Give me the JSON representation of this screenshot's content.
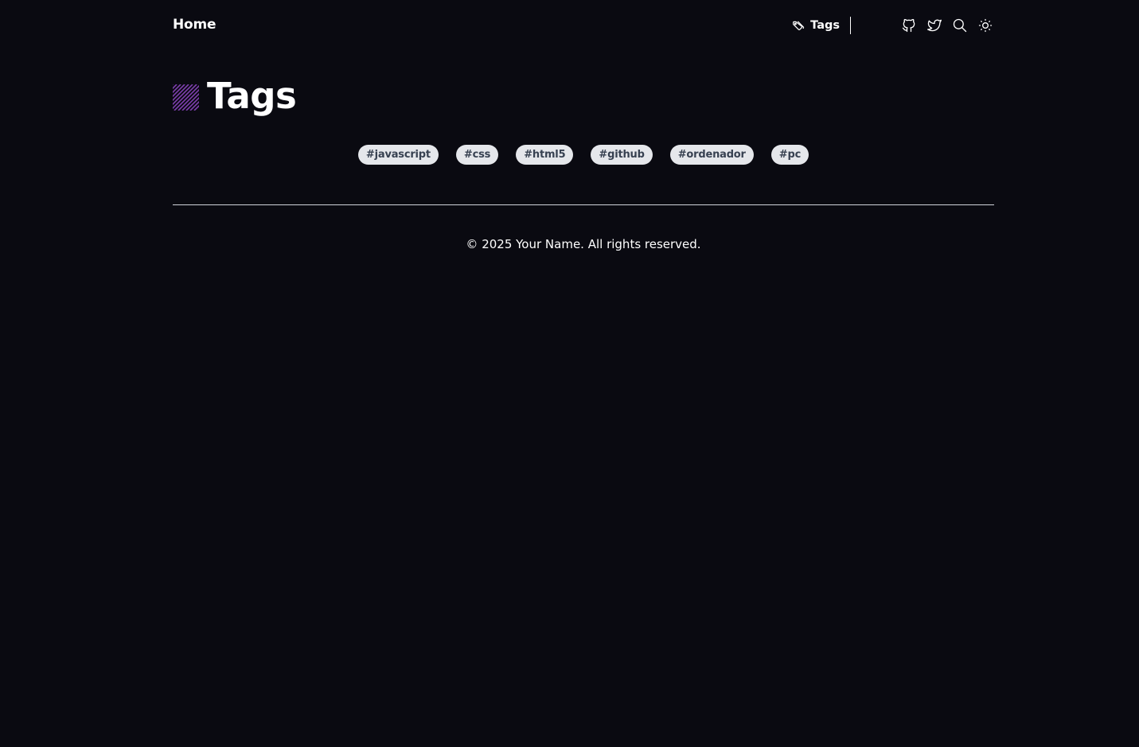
{
  "header": {
    "brand": "Home",
    "nav_tags_label": "Tags",
    "icons": [
      "github-icon",
      "twitter-icon",
      "search-icon",
      "sun-icon"
    ]
  },
  "main": {
    "title": "Tags",
    "tags": [
      "#javascript",
      "#css",
      "#html5",
      "#github",
      "#ordenador",
      "#pc"
    ]
  },
  "footer": {
    "text": "© 2025 Your Name. All rights reserved."
  },
  "colors": {
    "background": "#0a0a11",
    "tag_bg": "#e5e7eb",
    "tag_text": "#374151",
    "accent": "#7e3fae"
  }
}
